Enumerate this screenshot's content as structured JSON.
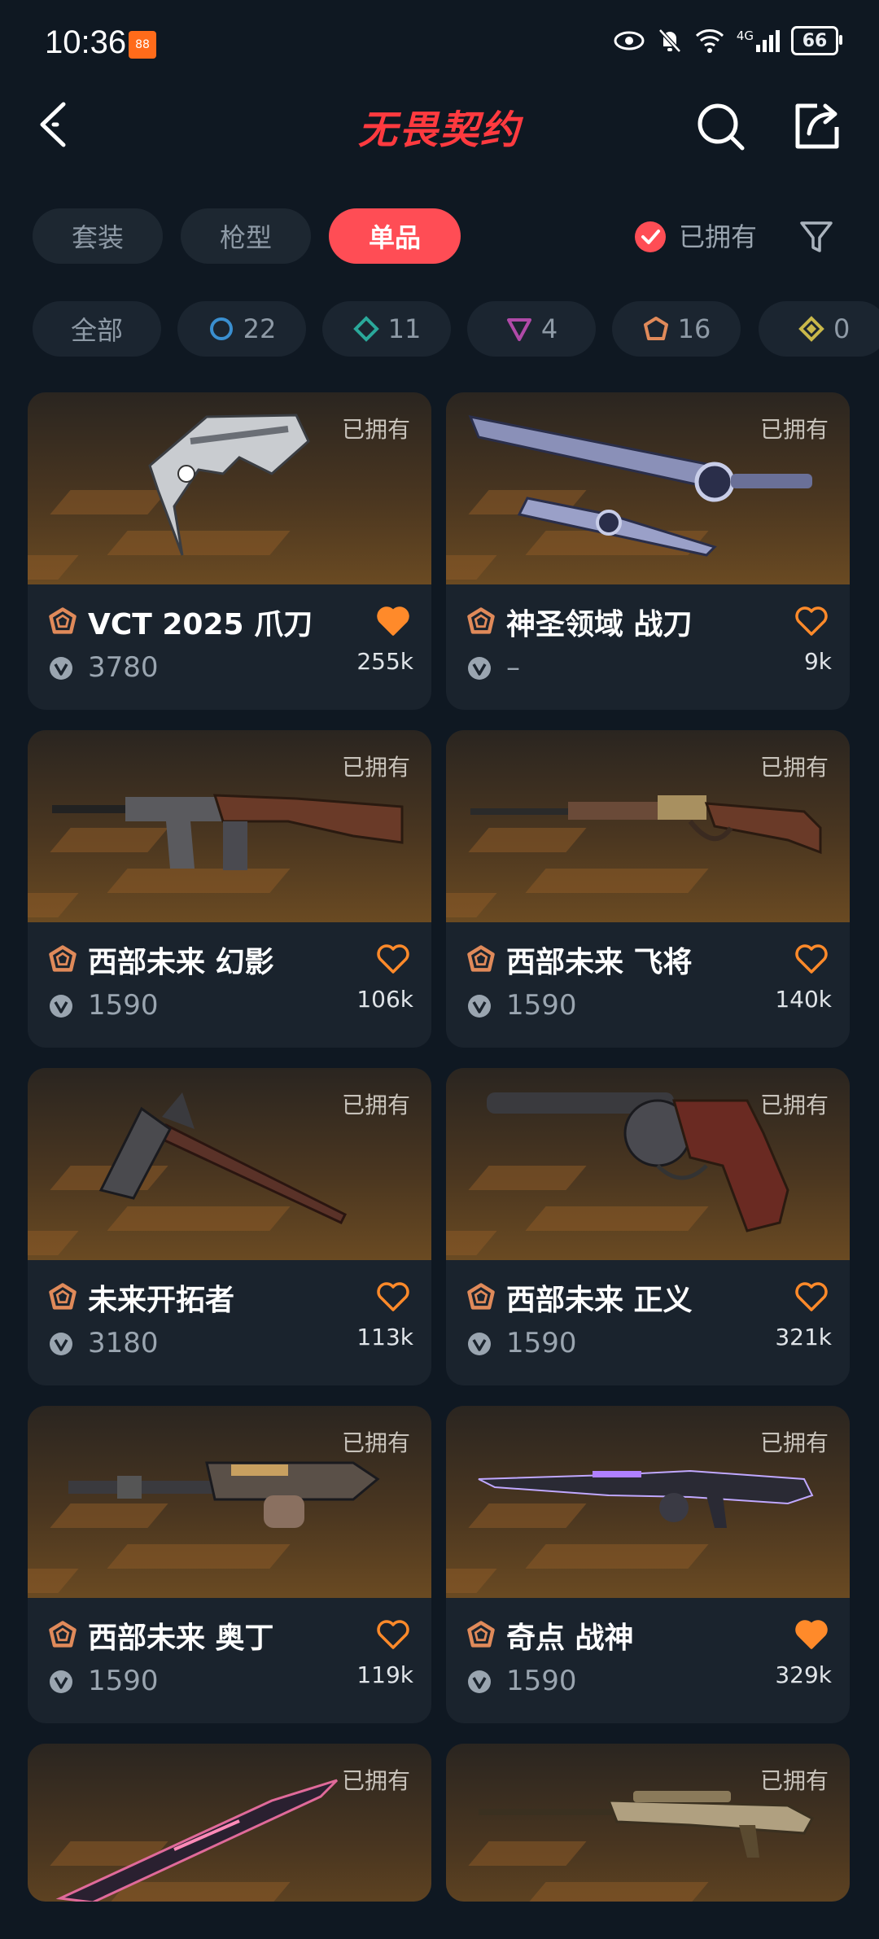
{
  "status_bar": {
    "time": "10:36",
    "app_badge": "88",
    "network": "4G",
    "battery": "66"
  },
  "header": {
    "title": "无畏契约",
    "back_icon": "back-arrow-icon",
    "search_icon": "search-icon",
    "share_icon": "share-icon"
  },
  "tabs": [
    {
      "label": "套装",
      "active": false
    },
    {
      "label": "枪型",
      "active": false
    },
    {
      "label": "单品",
      "active": true
    }
  ],
  "owned_filter": {
    "label": "已拥有",
    "checked": true
  },
  "rarity_chips": [
    {
      "label": "全部"
    },
    {
      "label": "22",
      "color": "#3a8fd0",
      "shape": "circle"
    },
    {
      "label": "11",
      "color": "#2aa89a",
      "shape": "diamond"
    },
    {
      "label": "4",
      "color": "#b04aa8",
      "shape": "triangle"
    },
    {
      "label": "16",
      "color": "#e08a5a",
      "shape": "pentagon"
    },
    {
      "label": "0",
      "color": "#c9b84a",
      "shape": "diamond"
    }
  ],
  "items": [
    {
      "name": "VCT 2025 爪刀",
      "owned": "已拥有",
      "price": "3780",
      "likes": "255k",
      "liked": true,
      "weapon": "karambit"
    },
    {
      "name": "神圣领域 战刀",
      "owned": "已拥有",
      "price": "–",
      "likes": "9k",
      "liked": false,
      "weapon": "sword"
    },
    {
      "name": "西部未来 幻影",
      "owned": "已拥有",
      "price": "1590",
      "likes": "106k",
      "liked": false,
      "weapon": "rifle"
    },
    {
      "name": "西部未来 飞将",
      "owned": "已拥有",
      "price": "1590",
      "likes": "140k",
      "liked": false,
      "weapon": "lever-rifle"
    },
    {
      "name": "未来开拓者",
      "owned": "已拥有",
      "price": "3180",
      "likes": "113k",
      "liked": false,
      "weapon": "axe"
    },
    {
      "name": "西部未来 正义",
      "owned": "已拥有",
      "price": "1590",
      "likes": "321k",
      "liked": false,
      "weapon": "revolver"
    },
    {
      "name": "西部未来 奥丁",
      "owned": "已拥有",
      "price": "1590",
      "likes": "119k",
      "liked": false,
      "weapon": "minigun"
    },
    {
      "name": "奇点 战神",
      "owned": "已拥有",
      "price": "1590",
      "likes": "329k",
      "liked": true,
      "weapon": "smg"
    },
    {
      "name": "",
      "owned": "已拥有",
      "price": "",
      "likes": "",
      "liked": false,
      "weapon": "knife"
    },
    {
      "name": "",
      "owned": "已拥有",
      "price": "",
      "likes": "",
      "liked": false,
      "weapon": "sniper"
    }
  ],
  "colors": {
    "accent": "#ff4d55",
    "rarity_exclusive": "#e08a5a",
    "heart_filled": "#ff8a2a",
    "background": "#0f1822"
  }
}
